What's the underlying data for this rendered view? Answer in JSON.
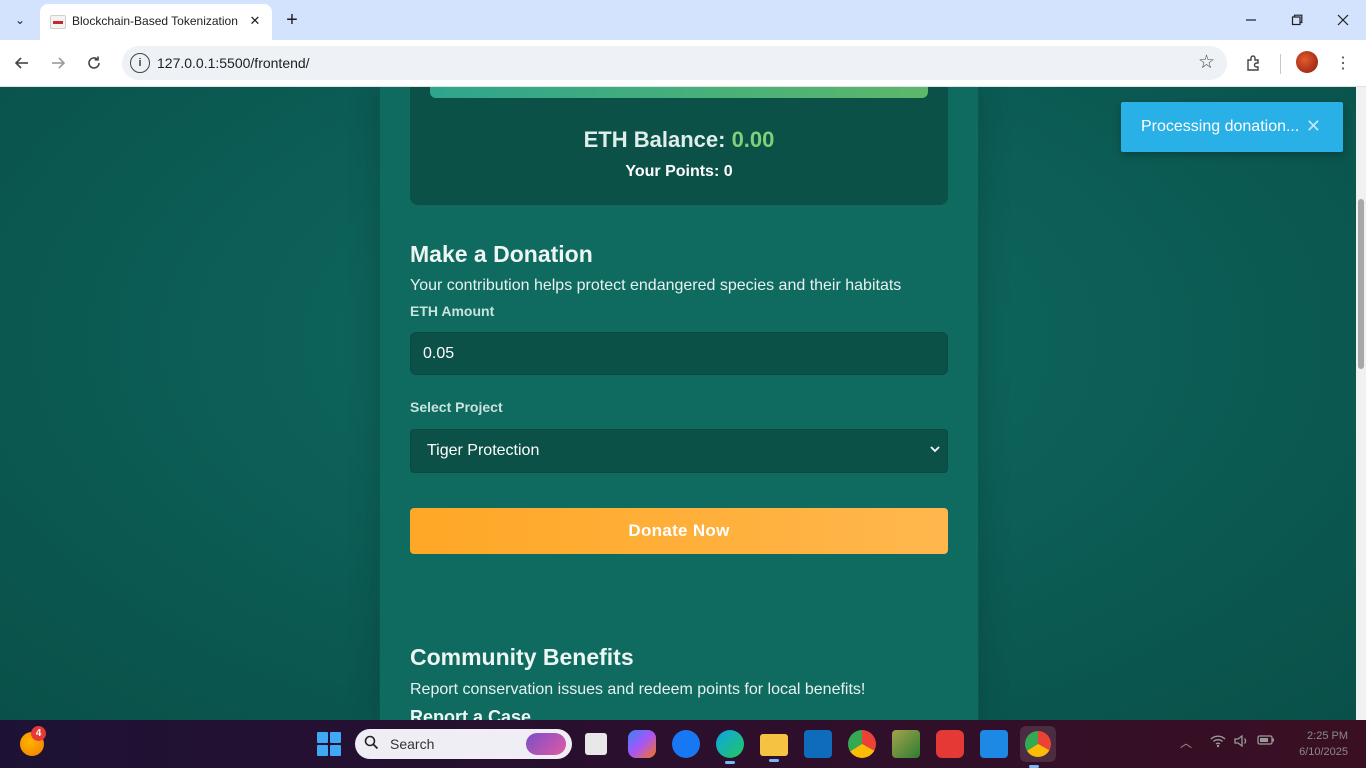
{
  "browser": {
    "tab_title": "Blockchain-Based Tokenization",
    "tab_close": "✕",
    "new_tab": "+",
    "url": "127.0.0.1:5500/frontend/",
    "info_icon": "i",
    "icons": [
      "tab-search-icon",
      "back-arrow-icon",
      "forward-arrow-icon",
      "reload-icon",
      "bookmark-star-icon",
      "extensions-icon",
      "profile-avatar",
      "kebab-menu-icon",
      "minimize-icon",
      "restore-icon",
      "close-icon"
    ]
  },
  "balance": {
    "label": "ETH Balance:",
    "value": "0.00",
    "points": "Your Points: 0"
  },
  "donation": {
    "title": "Make a Donation",
    "subtitle": "Your contribution helps protect endangered species and their habitats",
    "amount_label": "ETH Amount",
    "amount_value": "0.05",
    "project_label": "Select Project",
    "project_value": "Tiger Protection",
    "button": "Donate Now"
  },
  "community": {
    "title": "Community Benefits",
    "subtitle": "Report conservation issues and redeem points for local benefits!",
    "report_heading": "Report a Case"
  },
  "toast": {
    "message": "Processing donation...",
    "close": "✕"
  },
  "taskbar": {
    "search_label": "Search",
    "weather_badge": "4",
    "time": "2:25 PM",
    "date": "6/10/2025"
  },
  "colors": {
    "page_bg": "#0d5e57",
    "card_bg": "#0b5148",
    "balance_value": "#7ed17a",
    "donate_button": "#ffa726",
    "toast_bg": "#29b0e6"
  }
}
